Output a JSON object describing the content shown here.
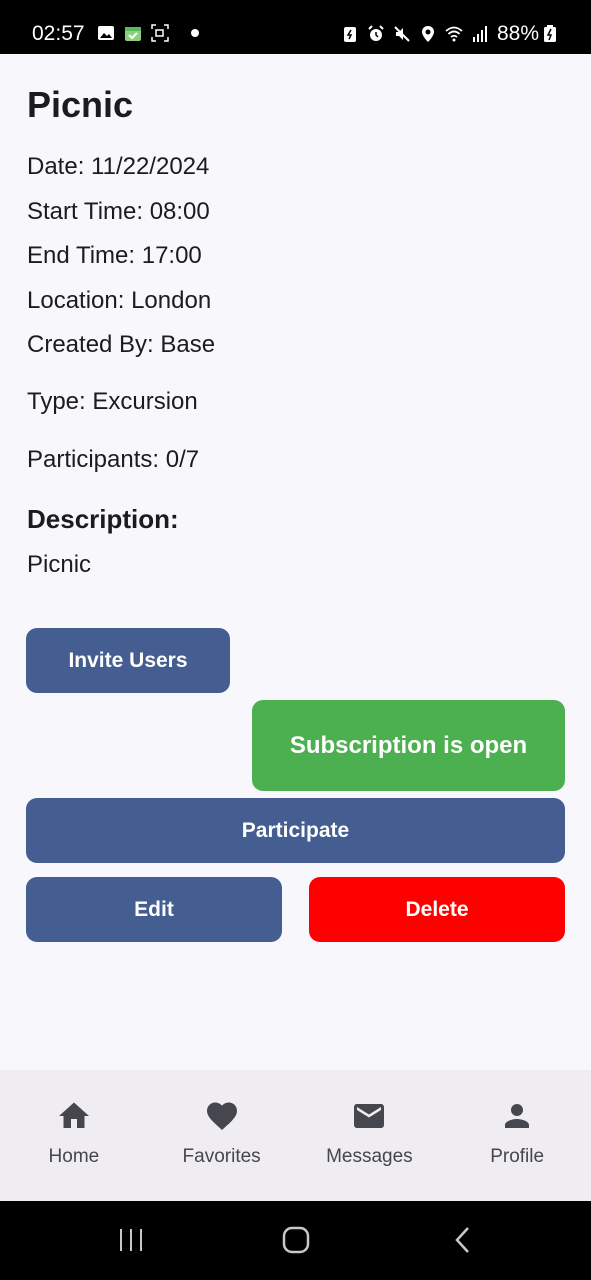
{
  "status_bar": {
    "time": "02:57",
    "battery": "88%",
    "left_icons": [
      "gallery-icon",
      "calendar-icon",
      "screen-record-icon",
      "dot-icon"
    ],
    "right_icons": [
      "battery-saver-icon",
      "alarm-icon",
      "mute-icon",
      "location-icon",
      "wifi-icon",
      "signal-icon",
      "battery-charging-icon"
    ]
  },
  "event": {
    "title": "Picnic",
    "date": "Date: 11/22/2024",
    "start_time": "Start Time: 08:00",
    "end_time": "End Time: 17:00",
    "location": "Location: London",
    "created_by": "Created By: Base",
    "type": "Type: Excursion",
    "participants": "Participants: 0/7",
    "description_label": "Description:",
    "description": "Picnic"
  },
  "actions": {
    "invite_users": "Invite Users",
    "subscription_status": "Subscription is open",
    "participate": "Participate",
    "edit": "Edit",
    "delete": "Delete"
  },
  "colors": {
    "primary": "#445e91",
    "success": "#4caf50",
    "danger": "#ff0000"
  },
  "bottom_nav": {
    "items": [
      {
        "label": "Home",
        "icon": "home-icon"
      },
      {
        "label": "Favorites",
        "icon": "heart-icon"
      },
      {
        "label": "Messages",
        "icon": "mail-icon"
      },
      {
        "label": "Profile",
        "icon": "person-icon"
      }
    ]
  }
}
